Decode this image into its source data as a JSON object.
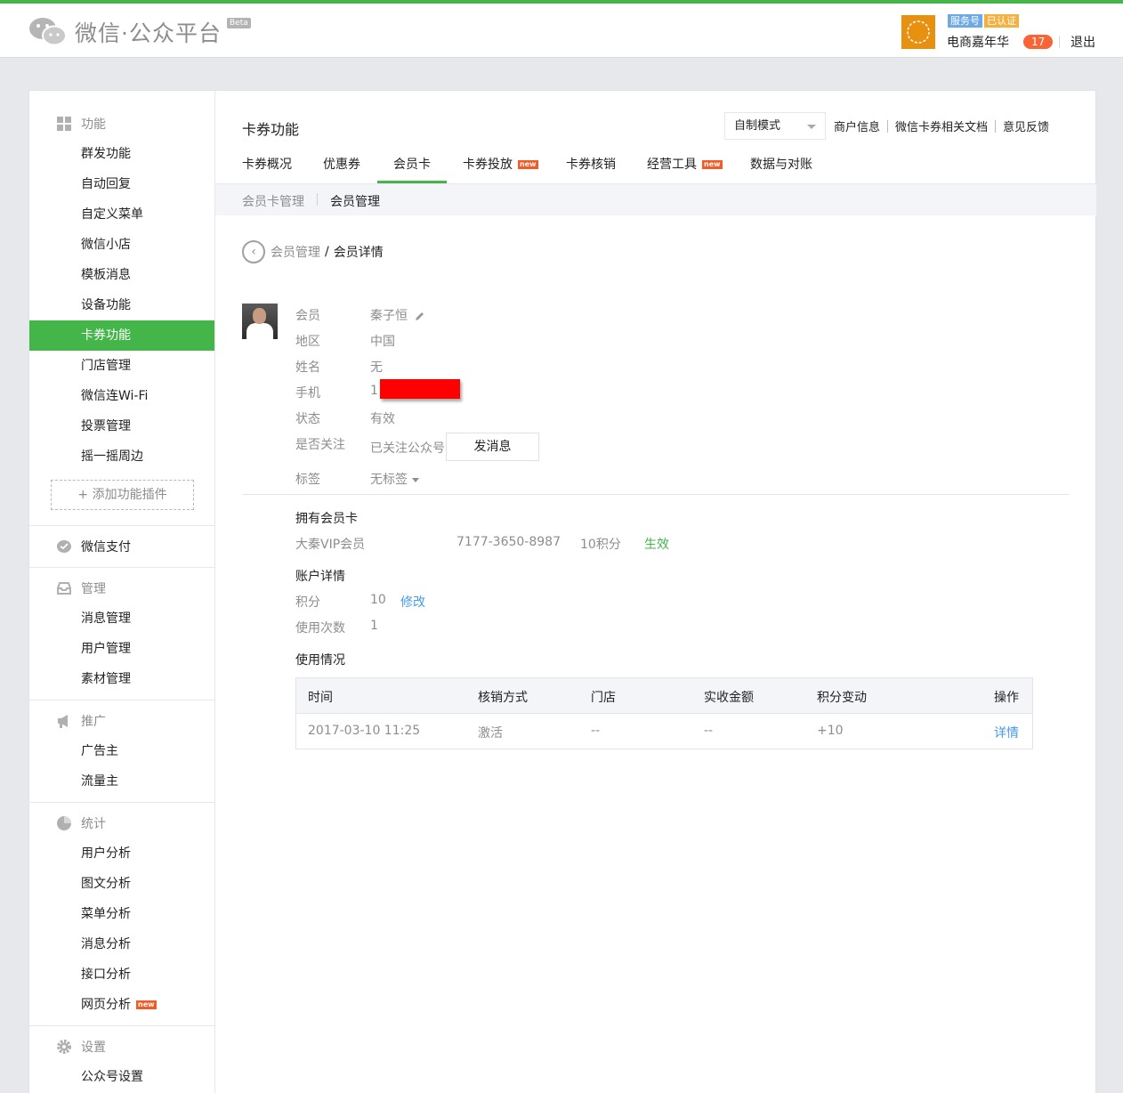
{
  "header": {
    "platform_title": "微信·公众平台",
    "beta": "Beta",
    "account_type": "服务号",
    "verified": "已认证",
    "account_name": "电商嘉年华",
    "notice_count": "17",
    "logout": "退出"
  },
  "sidebar": {
    "section_func": "功能",
    "func_items": [
      "群发功能",
      "自动回复",
      "自定义菜单",
      "微信小店",
      "模板消息",
      "设备功能",
      "卡券功能",
      "门店管理",
      "微信连Wi-Fi",
      "投票管理",
      "摇一摇周边"
    ],
    "add_plugin": "添加功能插件",
    "section_pay": "微信支付",
    "section_manage": "管理",
    "manage_items": [
      "消息管理",
      "用户管理",
      "素材管理"
    ],
    "section_promo": "推广",
    "promo_items": [
      "广告主",
      "流量主"
    ],
    "section_stats": "统计",
    "stats_items": [
      "用户分析",
      "图文分析",
      "菜单分析",
      "消息分析",
      "接口分析",
      "网页分析"
    ],
    "new_label": "new",
    "section_settings": "设置",
    "settings_items": [
      "公众号设置"
    ]
  },
  "main": {
    "title": "卡券功能",
    "mode": "自制模式",
    "top_links": [
      "商户信息",
      "微信卡券相关文档",
      "意见反馈"
    ],
    "tabs": [
      "卡券概况",
      "优惠券",
      "会员卡",
      "卡券投放",
      "卡券核销",
      "经营工具",
      "数据与对账"
    ],
    "subnav": [
      "会员卡管理",
      "会员管理"
    ],
    "breadcrumb_parent": "会员管理",
    "breadcrumb_sep": "/",
    "breadcrumb_current": "会员详情"
  },
  "member": {
    "labels": {
      "member": "会员",
      "region": "地区",
      "name": "姓名",
      "phone": "手机",
      "status": "状态",
      "follow": "是否关注",
      "tag": "标签"
    },
    "nickname": "秦子恒",
    "region": "中国",
    "name": "无",
    "phone_visible": "1",
    "status": "有效",
    "follow": "已关注公众号",
    "send_button": "发消息",
    "tag": "无标签"
  },
  "cards": {
    "section": "拥有会员卡",
    "card_name": "大秦VIP会员",
    "card_no": "7177-3650-8987",
    "points": "10积分",
    "state": "生效"
  },
  "account": {
    "section": "账户详情",
    "points_label": "积分",
    "points_value": "10",
    "edit": "修改",
    "uses_label": "使用次数",
    "uses_value": "1"
  },
  "usage": {
    "section": "使用情况",
    "columns": [
      "时间",
      "核销方式",
      "门店",
      "实收金额",
      "积分变动",
      "操作"
    ],
    "rows": [
      [
        "2017-03-10 11:25",
        "激活",
        "--",
        "--",
        "+10",
        "详情"
      ]
    ]
  }
}
